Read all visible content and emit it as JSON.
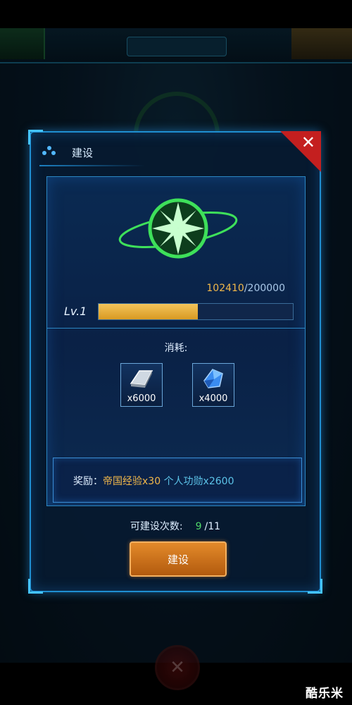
{
  "dialog": {
    "title": "建设",
    "close_icon": "close-icon",
    "level_label": "Lv.1",
    "xp": {
      "current": "102410",
      "separator": "/",
      "max": "200000",
      "fraction": 0.512
    },
    "cost_label": "消耗:",
    "cost_items": [
      {
        "icon": "silver-ingot-icon",
        "quantity": "x6000"
      },
      {
        "icon": "blue-crystal-icon",
        "quantity": "x4000"
      }
    ],
    "reward": {
      "label": "奖励：",
      "item1": "帝国经验x30",
      "item2": "个人功勋x2600"
    },
    "build_count": {
      "label": "可建设次数:",
      "current": "9",
      "max": "/11"
    },
    "build_button": "建设"
  },
  "watermark": "酷乐米",
  "colors": {
    "accent_blue": "#1f8fd1",
    "xp_gold": "#f2b84a",
    "count_green": "#4fd86a",
    "button_orange": "#e38a2a",
    "close_red": "#c41f1f"
  }
}
